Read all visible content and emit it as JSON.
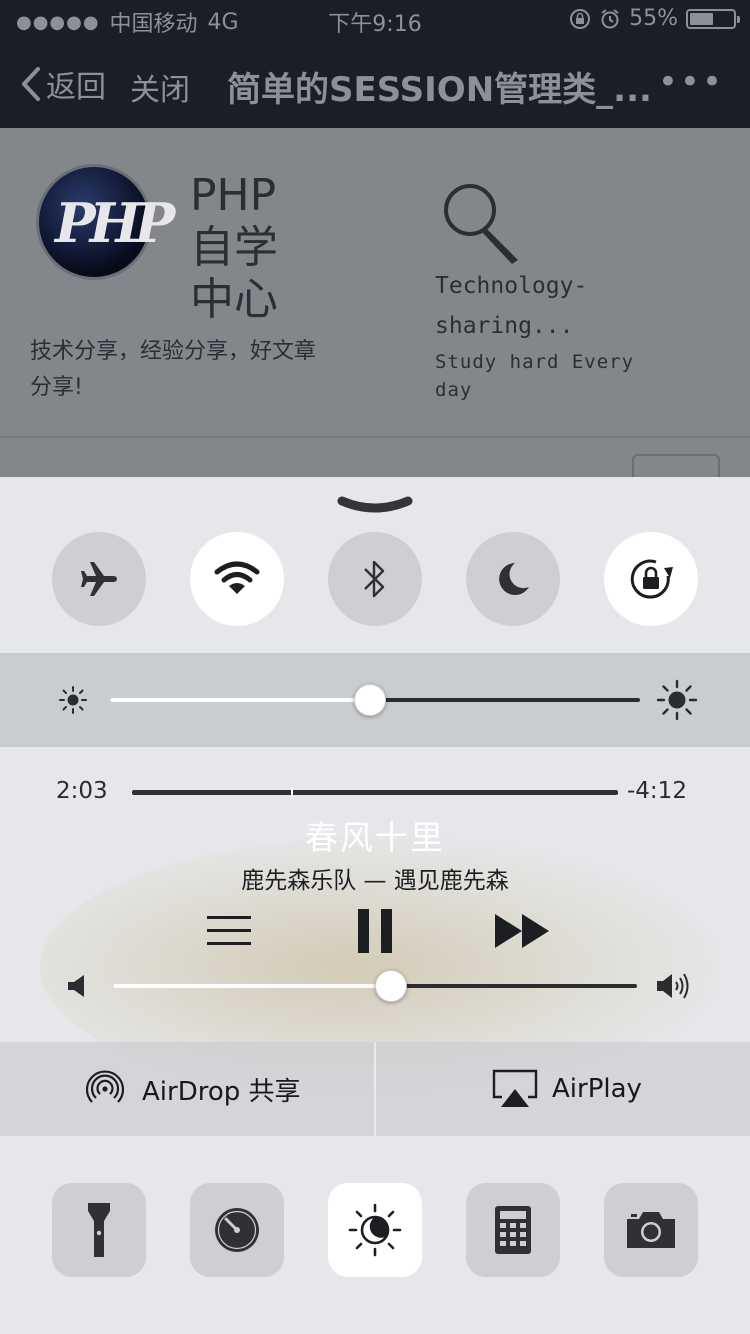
{
  "status_bar": {
    "signal_dots": "●●●●●",
    "carrier": "中国移动",
    "network": "4G",
    "time": "下午9:16",
    "battery": "55%",
    "battery_level": 0.55,
    "icons": [
      "orientation-lock-icon",
      "alarm-icon"
    ]
  },
  "nav": {
    "back_label": "返回",
    "close_label": "关闭",
    "title": "简单的SESSION管理类_...",
    "more_label": "•••"
  },
  "page": {
    "left_card": {
      "name": "PHP\n自学\n中心",
      "desc": "技术分享，经验分享，好文章分享!",
      "logo_text": "PHP"
    },
    "right_card": {
      "name": "Technology-sharing...",
      "desc": "Study hard Every day"
    }
  },
  "control_center": {
    "toggles": [
      {
        "name": "airplane-mode",
        "icon": "airplane-icon",
        "on": false
      },
      {
        "name": "wifi",
        "icon": "wifi-icon",
        "on": true
      },
      {
        "name": "bluetooth",
        "icon": "bluetooth-icon",
        "on": false
      },
      {
        "name": "do-not-disturb",
        "icon": "moon-icon",
        "on": false
      },
      {
        "name": "rotation-lock",
        "icon": "rotation-lock-icon",
        "on": true
      }
    ],
    "brightness_level": 0.49,
    "now_playing": {
      "elapsed": "2:03",
      "remaining": "-4:12",
      "progress": 0.33,
      "title": "春风十里",
      "artist_album": "鹿先森乐队 — 遇见鹿先森",
      "controls": [
        "list-icon",
        "pause-icon",
        "fast-forward-icon"
      ]
    },
    "volume_level": 0.53,
    "airdrop_label": "AirDrop 共享",
    "airplay_label": "AirPlay",
    "tools": [
      {
        "name": "flashlight",
        "icon": "flashlight-icon",
        "on": false
      },
      {
        "name": "timer",
        "icon": "timer-icon",
        "on": false
      },
      {
        "name": "night-shift",
        "icon": "night-shift-icon",
        "on": true
      },
      {
        "name": "calculator",
        "icon": "calculator-icon",
        "on": false
      },
      {
        "name": "camera",
        "icon": "camera-icon",
        "on": false
      }
    ]
  }
}
